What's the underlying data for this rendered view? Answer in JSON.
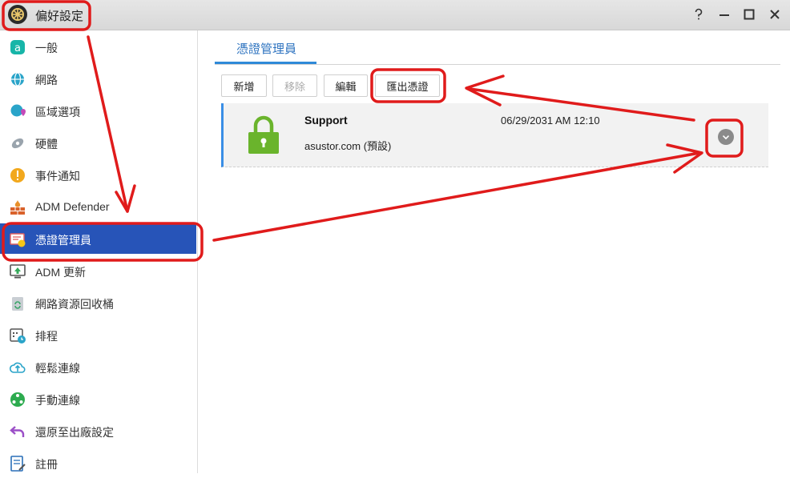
{
  "window": {
    "title": "偏好設定",
    "icons": [
      "help-icon",
      "minimize-icon",
      "maximize-icon",
      "close-icon"
    ]
  },
  "sidebar": {
    "items": [
      {
        "label": "一般",
        "icon": "general-icon",
        "active": false
      },
      {
        "label": "網路",
        "icon": "globe-icon",
        "active": false
      },
      {
        "label": "區域選項",
        "icon": "region-icon",
        "active": false
      },
      {
        "label": "硬體",
        "icon": "hardware-icon",
        "active": false
      },
      {
        "label": "事件通知",
        "icon": "alert-icon",
        "active": false
      },
      {
        "label": "ADM Defender",
        "icon": "firewall-icon",
        "active": false
      },
      {
        "label": "憑證管理員",
        "icon": "certificate-icon",
        "active": true
      },
      {
        "label": "ADM 更新",
        "icon": "update-icon",
        "active": false
      },
      {
        "label": "網路資源回收桶",
        "icon": "recycle-icon",
        "active": false
      },
      {
        "label": "排程",
        "icon": "schedule-icon",
        "active": false
      },
      {
        "label": "輕鬆連線",
        "icon": "cloud-icon",
        "active": false
      },
      {
        "label": "手動連線",
        "icon": "network-icon",
        "active": false
      },
      {
        "label": "還原至出廠設定",
        "icon": "undo-icon",
        "active": false
      },
      {
        "label": "註冊",
        "icon": "register-icon",
        "active": false
      }
    ]
  },
  "main": {
    "tab_label": "憑證管理員",
    "toolbar": {
      "add_label": "新增",
      "remove_label": "移除",
      "edit_label": "編輯",
      "export_label": "匯出憑證"
    },
    "certificate": {
      "name": "Support",
      "domain": "asustor.com (預設)",
      "expires": "06/29/2031 AM 12:10"
    }
  },
  "colors": {
    "accent": "#2754b8",
    "tab": "#2f74c0",
    "annotation": "#e01b1b",
    "lock": "#6ab42c"
  }
}
